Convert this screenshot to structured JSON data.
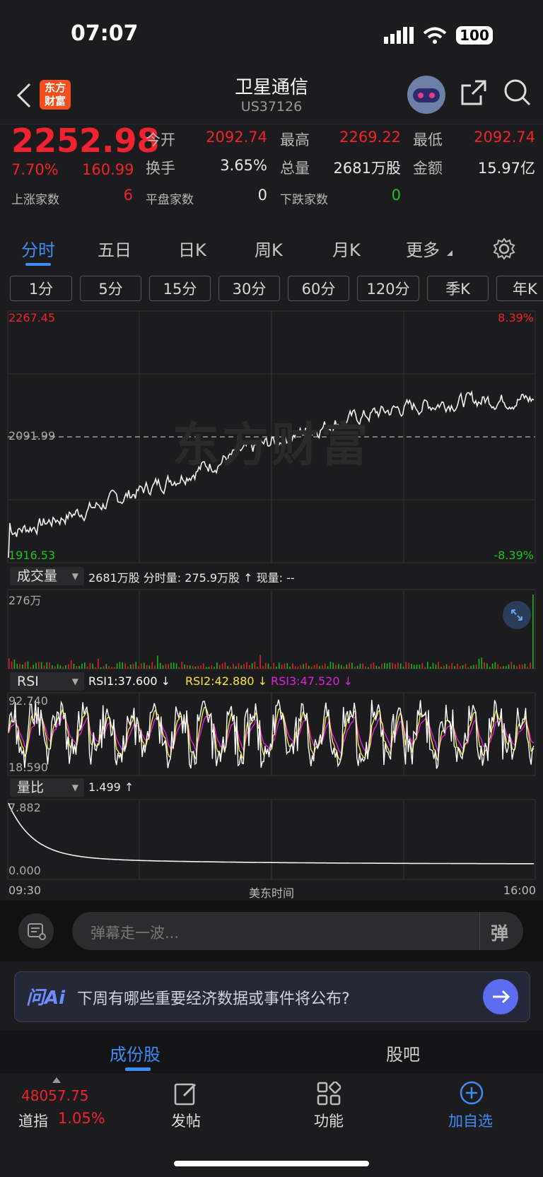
{
  "status_bar": {
    "time": "07:07",
    "battery": "100"
  },
  "header": {
    "logo_line1": "东方",
    "logo_line2": "财富",
    "title": "卫星通信",
    "code": "US37126"
  },
  "quote": {
    "price": "2252.98",
    "change_pct": "7.70%",
    "change": "160.99",
    "open_label": "今开",
    "open": "2092.74",
    "high_label": "最高",
    "high": "2269.22",
    "low_label": "最低",
    "low": "2092.74",
    "turnover_label": "换手",
    "turnover": "3.65%",
    "volume_label": "总量",
    "volume": "2681万股",
    "amount_label": "金额",
    "amount": "15.97亿",
    "up_label": "上涨家数",
    "up": "6",
    "flat_label": "平盘家数",
    "flat": "0",
    "down_label": "下跌家数",
    "down": "0"
  },
  "tabs": [
    "分时",
    "五日",
    "日K",
    "周K",
    "月K",
    "更多"
  ],
  "periods": [
    "1分",
    "5分",
    "15分",
    "30分",
    "60分",
    "120分",
    "季K",
    "年K"
  ],
  "price_chart": {
    "max": "2267.45",
    "max_pct": "8.39%",
    "mid": "2091.99",
    "min": "1916.53",
    "min_pct": "-8.39%",
    "watermark": "东方财富"
  },
  "volume": {
    "selector": "成交量",
    "info": "2681万股 分时量: 275.9万股 ↑ 现量: --",
    "max": "276万"
  },
  "rsi": {
    "selector": "RSI",
    "rsi1": "RSI1:37.600 ↓",
    "rsi2": "RSI2:42.880 ↓",
    "rsi3": "RSI3:47.520 ↓",
    "max": "92.740",
    "min": "18.590"
  },
  "ratio": {
    "selector": "量比",
    "info": "1.499 ↑",
    "max": "7.882",
    "min": "0.000"
  },
  "time_axis": {
    "start": "09:30",
    "mid": "美东时间",
    "end": "16:00"
  },
  "comment": {
    "placeholder": "弹幕走一波...",
    "danmu": "弹"
  },
  "ai": {
    "brand": "问Ai",
    "question": "下周有哪些重要经济数据或事件将公布?"
  },
  "subtabs": [
    "成份股",
    "股吧"
  ],
  "bottom": {
    "index_value": "48057.75",
    "index_name": "道指",
    "index_pct": "1.05%",
    "post": "发帖",
    "func": "功能",
    "add": "加自选"
  },
  "colors": {
    "up": "#f0232e",
    "down": "#1ec51e",
    "accent": "#3d8df5",
    "rsi1": "#ffffff",
    "rsi2": "#f5e642",
    "rsi3": "#e020e0"
  }
}
